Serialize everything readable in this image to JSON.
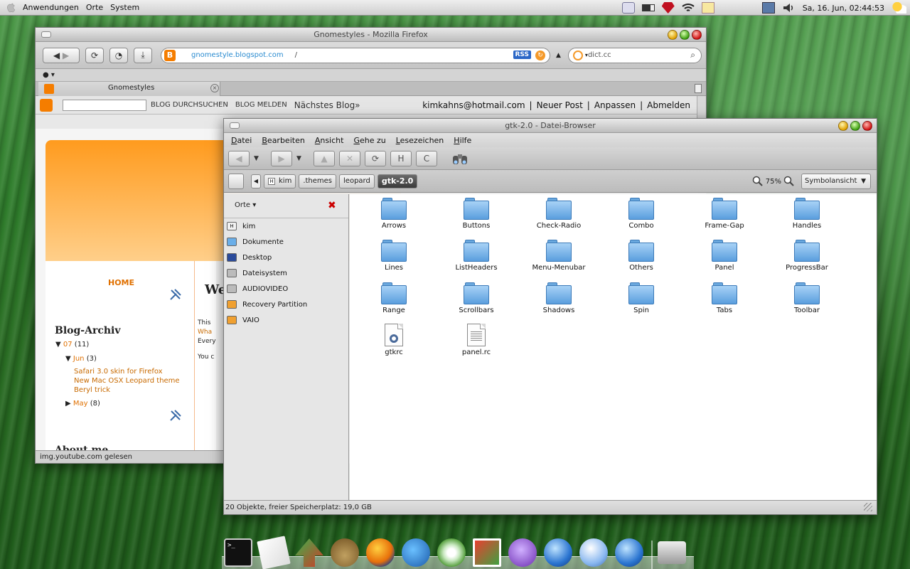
{
  "top_panel": {
    "menus": [
      "Anwendungen",
      "Orte",
      "System"
    ],
    "clock": "Sa, 16. Jun, 02:44:53",
    "tray_icons": [
      "clipboard-icon",
      "battery-icon",
      "ruby-icon",
      "wifi-icon",
      "notes-icon",
      "network-icon",
      "volume-icon",
      "weather-icon"
    ]
  },
  "firefox": {
    "title": "Gnomestyles - Mozilla Firefox",
    "url": "gnomestyle.blogspot.com",
    "url_suffix": "/",
    "rss": "RSS",
    "search_value": "dict.cc",
    "tab_label": "Gnomestyles",
    "blogger_bar": {
      "search_button": "BLOG DURCHSUCHEN",
      "report_button": "BLOG MELDEN",
      "next_blog": "Nächstes Blog»",
      "email": "kimkahns@hotmail.com",
      "new_post": "Neuer Post",
      "customize": "Anpassen",
      "sign_out": "Abmelden",
      "separator": "|"
    },
    "page": {
      "home": "HOME",
      "archive_title": "Blog-Archiv",
      "year": "07",
      "year_count": "(11)",
      "month": "Jun",
      "month_count": "(3)",
      "posts": [
        "Safari 3.0 skin for Firefox",
        "New Mac OSX Leopard theme",
        "Beryl trick"
      ],
      "month2": "May",
      "month2_count": "(8)",
      "about": "About me",
      "main_title": "We",
      "main_snippets": [
        "This",
        "Wha",
        "Every",
        "You c"
      ]
    },
    "status": "img.youtube.com gelesen"
  },
  "nautilus": {
    "title": "gtk-2.0 - Datei-Browser",
    "menus": [
      {
        "u": "D",
        "rest": "atei"
      },
      {
        "u": "B",
        "rest": "earbeiten"
      },
      {
        "u": "A",
        "rest": "nsicht"
      },
      {
        "u": "G",
        "rest": "ehe zu"
      },
      {
        "u": "L",
        "rest": "esezeichen"
      },
      {
        "u": "H",
        "rest": "ilfe"
      }
    ],
    "breadcrumbs": [
      "kim",
      ".themes",
      "leopard",
      "gtk-2.0"
    ],
    "zoom": "75%",
    "view_mode": "Symbolansicht",
    "sidebar_title": "Orte",
    "places": [
      "kim",
      "Dokumente",
      "Desktop",
      "Dateisystem",
      "AUDIOVIDEO",
      "Recovery Partition",
      "VAIO"
    ],
    "folders": [
      "Arrows",
      "Buttons",
      "Check-Radio",
      "Combo",
      "Frame-Gap",
      "Handles",
      "Lines",
      "ListHeaders",
      "Menu-Menubar",
      "Others",
      "Panel",
      "ProgressBar",
      "Range",
      "Scrollbars",
      "Shadows",
      "Spin",
      "Tabs",
      "Toolbar"
    ],
    "files": [
      "gtkrc",
      "panel.rc"
    ],
    "status": "20 Objekte, freier Speicherplatz: 19,0 GB"
  },
  "dock": {
    "items": [
      "terminal-icon",
      "text-editor-icon",
      "update-manager-icon",
      "gimp-icon",
      "firefox-icon",
      "messenger-icon",
      "music-player-icon",
      "photo-icon",
      "purple-app-icon",
      "web-globe-icon",
      "finder-icon",
      "network-globe-icon",
      "hard-drive-icon"
    ]
  }
}
